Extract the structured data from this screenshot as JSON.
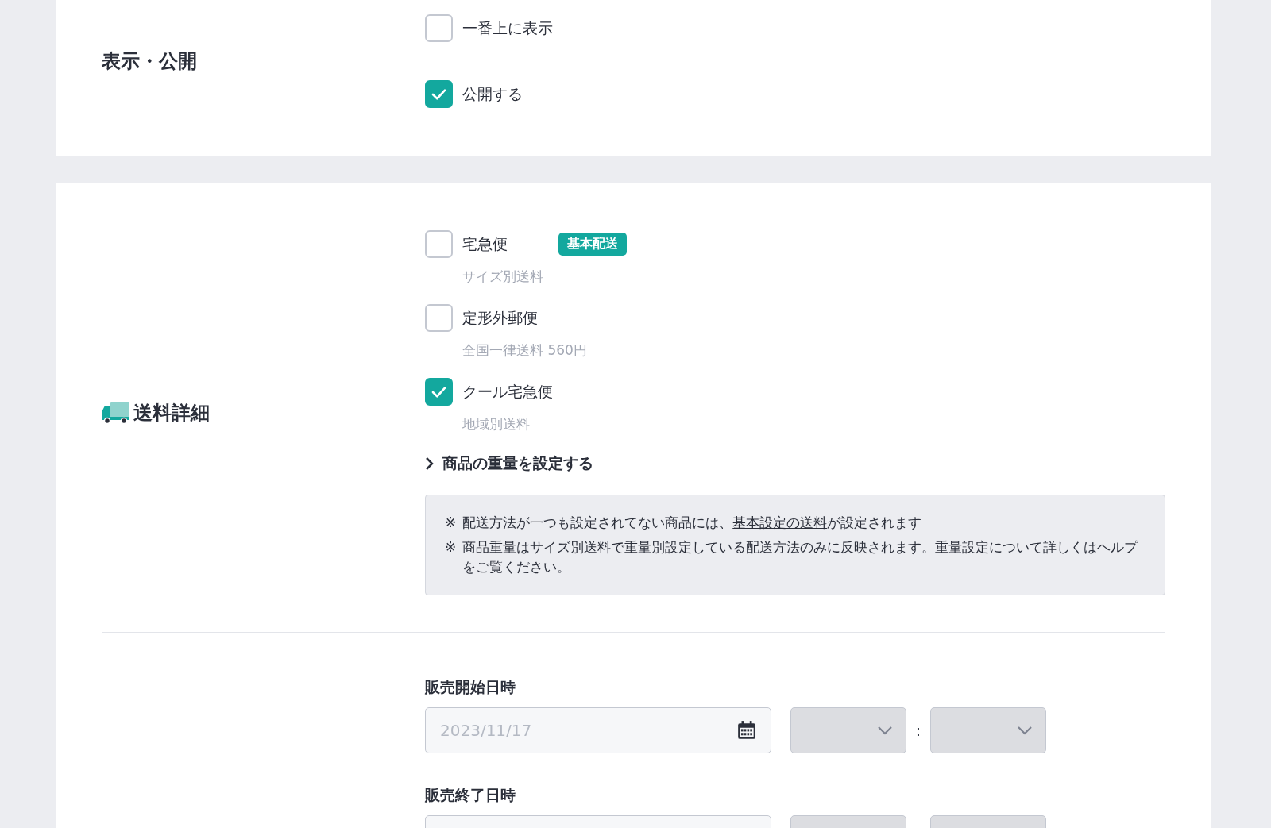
{
  "display_section": {
    "title": "表示・公開",
    "options": [
      {
        "label": "一番上に表示",
        "checked": false
      },
      {
        "label": "公開する",
        "checked": true
      }
    ]
  },
  "shipping_section": {
    "title": "送料詳細",
    "methods": [
      {
        "label": "宅急便",
        "checked": false,
        "badge": "基本配送",
        "description": "サイズ別送料"
      },
      {
        "label": "定形外郵便",
        "checked": false,
        "description": "全国一律送料 560円"
      },
      {
        "label": "クール宅急便",
        "checked": true,
        "description": "地域別送料"
      }
    ],
    "weight_toggle": {
      "label": "商品の重量を設定する",
      "expanded": false
    },
    "notes": [
      {
        "mark": "※",
        "parts": [
          {
            "text": "配送方法が一つも設定されてない商品には、"
          },
          {
            "link": "基本設定の送料"
          },
          {
            "text": "が設定されます"
          }
        ]
      },
      {
        "mark": "※",
        "parts": [
          {
            "text": "商品重量はサイズ別送料で重量別設定している配送方法のみに反映されます。重量設定について詳しくは"
          },
          {
            "link": "ヘルプ"
          },
          {
            "text": "をご覧ください。"
          }
        ]
      }
    ]
  },
  "sale_period": {
    "start": {
      "label": "販売開始日時",
      "placeholder": "2023/11/17",
      "separator": ":"
    },
    "end": {
      "label": "販売終了日時"
    }
  }
}
